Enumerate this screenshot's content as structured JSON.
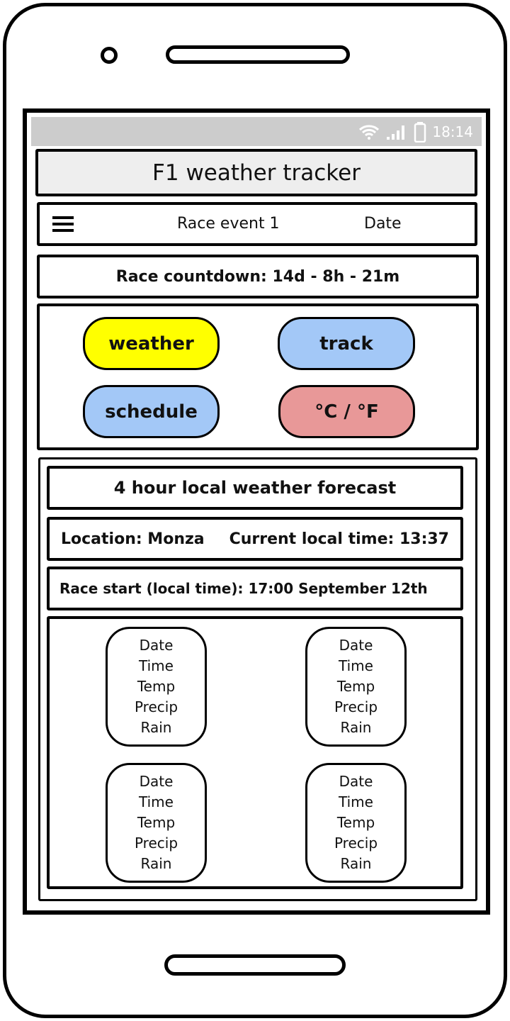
{
  "status_bar": {
    "time": "18:14",
    "icons": [
      "wifi-icon",
      "signal-icon",
      "battery-icon"
    ]
  },
  "header": {
    "title": "F1 weather tracker"
  },
  "nav": {
    "menu_icon": "hamburger-icon",
    "event": "Race event 1",
    "date": "Date"
  },
  "countdown": "Race countdown: 14d - 8h - 21m",
  "buttons": [
    {
      "label": "weather",
      "color": "#ffff00"
    },
    {
      "label": "track",
      "color": "#a3c8f7"
    },
    {
      "label": "schedule",
      "color": "#a3c8f7"
    },
    {
      "label": "°C / °F",
      "color": "#e89898"
    }
  ],
  "forecast": {
    "title": "4 hour local weather forecast",
    "location": "Location: Monza",
    "local_time": "Current local time: 13:37",
    "race_start": "Race start (local time): 17:00 September 12th",
    "cards": [
      {
        "date": "Date",
        "time": "Time",
        "temp": "Temp",
        "precip": "Precip",
        "rain": "Rain"
      },
      {
        "date": "Date",
        "time": "Time",
        "temp": "Temp",
        "precip": "Precip",
        "rain": "Rain"
      },
      {
        "date": "Date",
        "time": "Time",
        "temp": "Temp",
        "precip": "Precip",
        "rain": "Rain"
      },
      {
        "date": "Date",
        "time": "Time",
        "temp": "Temp",
        "precip": "Precip",
        "rain": "Rain"
      }
    ]
  }
}
